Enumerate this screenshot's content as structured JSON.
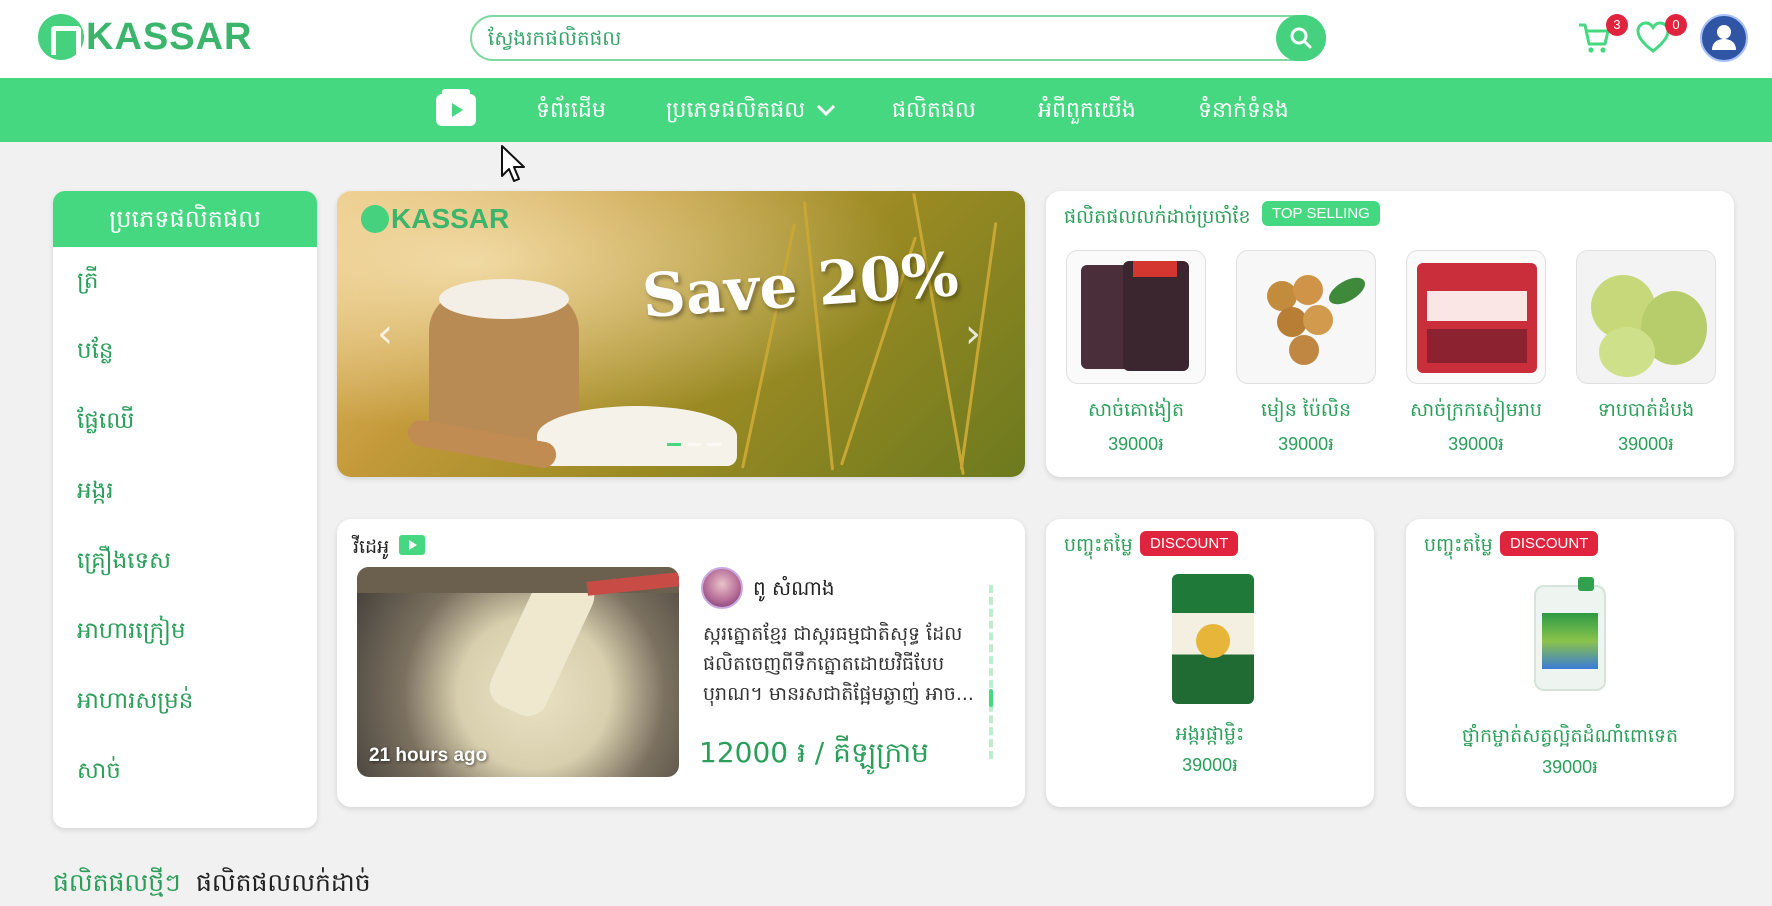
{
  "header": {
    "logo_text": "KASSAR",
    "search_placeholder": "ស្វែងរកផលិតផល",
    "cart_count": "3",
    "wishlist_count": "0"
  },
  "nav": {
    "items": [
      "ទំព័រដើម",
      "ប្រភេទផលិតផល",
      "ផលិតផល",
      "អំពីពួកយើង",
      "ទំនាក់ទំនង"
    ]
  },
  "sidebar": {
    "title": "ប្រភេទផលិតផល",
    "categories": [
      "ត្រី",
      "បន្លែ",
      "ផ្លែឈើ",
      "អង្ករ",
      "គ្រឿងទេស",
      "អាហារក្រៀម",
      "អាហារសម្រន់",
      "សាច់"
    ]
  },
  "banner": {
    "logo_text": "KASSAR",
    "headline": "Save 20%",
    "prev": "‹",
    "next": "›"
  },
  "top_selling": {
    "title": "ផលិតផលលក់ដាច់ប្រចាំខែ",
    "tag": "TOP SELLING",
    "products": [
      {
        "name": "សាច់គោងៀត",
        "price": "39000៛"
      },
      {
        "name": "មៀន ប៉ៃលិន",
        "price": "39000៛"
      },
      {
        "name": "សាច់ក្រកសៀមរាប",
        "price": "39000៛"
      },
      {
        "name": "ទាបបាត់ដំបង",
        "price": "39000៛"
      }
    ]
  },
  "video": {
    "title": "វីដេអូ",
    "time_ago": "21 hours ago",
    "seller": "ពូ សំណាង",
    "description": "ស្ករត្នោតខ្មែរ ជាស្ករធម្មជាតិសុទ្ធ ដែលផលិតចេញពីទឹកត្នោតដោយវិធីបែបបុរាណ។ មានរសជាតិផ្អែមឆ្ងាញ់ អាច...",
    "price": "12000 ៛ / គីឡូក្រាម"
  },
  "discounts": [
    {
      "title": "បញ្ចុះតម្លៃ",
      "tag": "DISCOUNT",
      "name": "អង្ករផ្កាម្លិះ",
      "price": "39000៛"
    },
    {
      "title": "បញ្ចុះតម្លៃ",
      "tag": "DISCOUNT",
      "name": "ថ្នាំកម្ចាត់សត្វល្អិតដំណាំពោទេត",
      "price": "39000៛"
    }
  ],
  "bottom_tabs": [
    "ផលិតផលថ្មីៗ",
    "ផលិតផលលក់ដាច់"
  ],
  "colors": {
    "brand_green": "#46d880",
    "text_green": "#2b9e5a",
    "badge_red": "#e0243e"
  }
}
